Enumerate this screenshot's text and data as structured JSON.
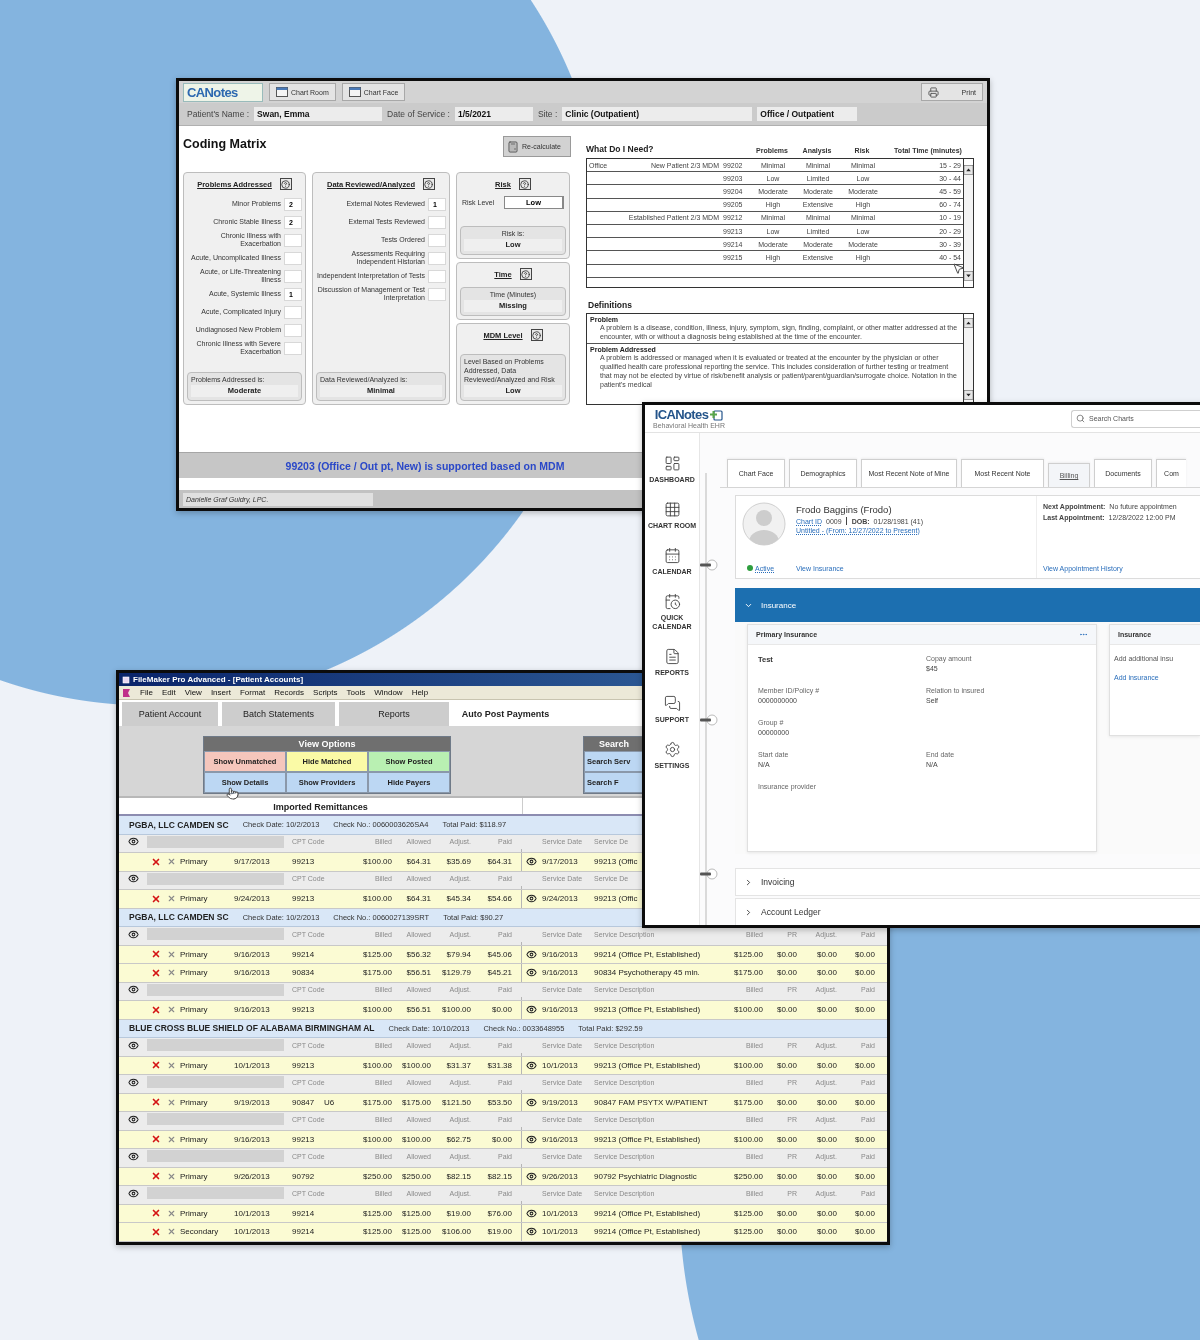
{
  "coding_matrix": {
    "logo": "CANotes",
    "toolbar": [
      "Chart Room",
      "Chart Face"
    ],
    "print_button": "Print",
    "patient_label": "Patient's Name :",
    "patient_name": "Swan, Emma",
    "date_label": "Date of Service :",
    "date": "1/5/2021",
    "site_label": "Site :",
    "site": "Clinic (Outpatient)",
    "setting": "Office / Outpatient",
    "title": "Coding Matrix",
    "recalculate_button": "Re-calculate",
    "panels": [
      {
        "title": "Problems Addressed",
        "items": [
          {
            "label": "Minor Problems",
            "value": "2"
          },
          {
            "label": "Chronic Stable Illness",
            "value": "2"
          },
          {
            "label": "Chronic Illness with Exacerbation"
          },
          {
            "label": "Acute, Uncomplicated Illness"
          },
          {
            "label": "Acute, or Life-Threatening Illness"
          },
          {
            "label": "Acute, Systemic Illness",
            "value": "1"
          },
          {
            "label": "Acute, Complicated Injury"
          },
          {
            "label": "Undiagnosed New Problem"
          },
          {
            "label": "Chronic Illness with Severe Exacerbation"
          }
        ],
        "summary_label": "Problems Addressed is:",
        "summary": "Moderate"
      },
      {
        "title": "Data Reviewed/Analyzed",
        "items": [
          {
            "label": "External Notes Reviewed",
            "value": "1"
          },
          {
            "label": "External Tests Reviewed"
          },
          {
            "label": "Tests Ordered"
          },
          {
            "label": "Assessments Requiring Independent Historian"
          },
          {
            "label": "Independent Interpretation of Tests"
          },
          {
            "label": "Discussion of Management or Test Interpretation"
          }
        ],
        "summary_label": "Data Reviewed/Analyzed is:",
        "summary": "Minimal"
      }
    ],
    "risk": {
      "title": "Risk",
      "field_label": "Risk Level",
      "field_value": "Low",
      "summary_label": "Risk is:",
      "summary": "Low"
    },
    "time": {
      "title": "Time",
      "summary_label": "Time (Minutes)",
      "summary": "Missing"
    },
    "mdm": {
      "title": "MDM Level",
      "summary_label": "Level Based on Problems Addressed, Data Reviewed/Analyzed and Risk",
      "summary": "Low"
    },
    "guide": {
      "title": "What Do I Need?",
      "columns": [
        "Problems",
        "Analysis",
        "Risk",
        "Total Time (minutes)"
      ],
      "rows": [
        {
          "column_1": "Office",
          "column_2": "New Patient 2/3 MDM",
          "code": "99202",
          "problems": "Minimal",
          "analysis": "Minimal",
          "risk": "Minimal",
          "time": "15 - 29"
        },
        {
          "code": "99203",
          "problems": "Low",
          "analysis": "Limited",
          "risk": "Low",
          "time": "30 - 44"
        },
        {
          "code": "99204",
          "problems": "Moderate",
          "analysis": "Moderate",
          "risk": "Moderate",
          "time": "45 - 59"
        },
        {
          "code": "99205",
          "problems": "High",
          "analysis": "Extensive",
          "risk": "High",
          "time": "60 - 74"
        },
        {
          "column_2": "Established Patient 2/3 MDM",
          "code": "99212",
          "problems": "Minimal",
          "analysis": "Minimal",
          "risk": "Minimal",
          "time": "10 - 19"
        },
        {
          "code": "99213",
          "problems": "Low",
          "analysis": "Limited",
          "risk": "Low",
          "time": "20 - 29"
        },
        {
          "code": "99214",
          "problems": "Moderate",
          "analysis": "Moderate",
          "risk": "Moderate",
          "time": "30 - 39"
        },
        {
          "code": "99215",
          "problems": "High",
          "analysis": "Extensive",
          "risk": "High",
          "time": "40 - 54"
        }
      ]
    },
    "definitions": {
      "title": "Definitions",
      "entries": [
        {
          "term": "Problem",
          "text": "A problem is a disease, condition, illness, injury, symptom, sign, finding, complaint, or other matter addressed at the encounter, with or without a diagnosis being established at the time of the encounter."
        },
        {
          "term": "Problem Addressed",
          "text": "A problem is addressed or managed when it is evaluated or treated at the encounter by the physician or other qualified health care professional reporting the service. This includes consideration of further testing or treatment that may not be elected by virtue of risk/benefit analysis or patient/parent/guardian/surrogate choice. Notation in the patient's medical"
        }
      ]
    },
    "result": "99203 (Office / Out pt, New) is supported based on MDM",
    "footer": "Danielle Graf Guidry, LPC."
  },
  "icanotes": {
    "logo": "ICANotes",
    "tagline": "Behavioral Health EHR",
    "search": {
      "placeholder": "Search Charts"
    },
    "nav": [
      {
        "label": "DASHBOARD",
        "kind": "dashboard"
      },
      {
        "label": "CHART ROOM",
        "kind": "chart_room"
      },
      {
        "label": "CALENDAR",
        "kind": "calendar"
      },
      {
        "label": "QUICK CALENDAR",
        "kind": "quick_calendar"
      },
      {
        "label": "REPORTS",
        "kind": "reports"
      },
      {
        "label": "SUPPORT",
        "kind": "support"
      },
      {
        "label": "SETTINGS",
        "kind": "settings"
      }
    ],
    "tabs": [
      {
        "label": "Chart Face",
        "selected": false
      },
      {
        "label": "Demographics",
        "selected": false
      },
      {
        "label": "Most Recent Note of Mine",
        "selected": false
      },
      {
        "label": "Most Recent Note",
        "selected": false
      },
      {
        "label": "Billing",
        "selected": true
      },
      {
        "label": "Documents",
        "selected": false
      },
      {
        "label": "Com",
        "selected": false
      }
    ],
    "patient": {
      "name": "Frodo Baggins (Frodo)",
      "chart_id_link": "Chart ID",
      "chart_id": "0009",
      "dob_label": "DOB:",
      "dob": "01/28/1981 (41)",
      "episode_link": "Untitled - (From: 12/27/2022 to Present)",
      "status": {
        "label": "Active",
        "active": true
      },
      "insurance_link": "View Insurance",
      "next_label": "Next Appointment:",
      "next": "No future appointmen",
      "last_label": "Last Appointment:",
      "last": "12/28/2022 12:00 PM",
      "history_link": "View Appointment History"
    },
    "sections": [
      {
        "title": "Insurance",
        "expanded": true
      },
      {
        "title": "Invoicing",
        "expanded": false
      },
      {
        "title": "Account Ledger",
        "expanded": false
      }
    ],
    "primary_card": {
      "title": "Primary Insurance",
      "rows": [
        [
          {
            "heading": "Test"
          },
          {
            "label": "Copay amount",
            "value": "$45"
          }
        ],
        [
          {
            "label": "Member ID/Policy #",
            "value": "0000000000"
          },
          {
            "label": "Relation to insured",
            "value": "Self"
          }
        ],
        [
          {
            "label": "Group #",
            "value": "00000000"
          }
        ],
        [
          {
            "label": "Start date",
            "value": "N/A"
          },
          {
            "label": "End date",
            "value": "N/A"
          }
        ],
        [
          {
            "label": "Insurance provider"
          }
        ]
      ]
    },
    "secondary_card": {
      "title": "Insurance",
      "text": "Add additional insu",
      "link": "Add insurance"
    }
  },
  "filemaker": {
    "title": "FileMaker Pro Advanced - [Patient Accounts]",
    "menu": [
      "File",
      "Edit",
      "View",
      "Insert",
      "Format",
      "Records",
      "Scripts",
      "Tools",
      "Window",
      "Help"
    ],
    "tabs": [
      {
        "label": "Patient Account",
        "selected": false
      },
      {
        "label": "Batch Statements",
        "selected": false
      },
      {
        "label": "Reports",
        "selected": false
      },
      {
        "label": "Auto Post Payments",
        "selected": true
      }
    ],
    "view_options": {
      "title": "View Options",
      "buttons": [
        {
          "label": "Show Unmatched",
          "color": "#f5c6bc"
        },
        {
          "label": "Hide Matched",
          "color": "#fafaa6"
        },
        {
          "label": "Show Posted",
          "color": "#b9f0b2"
        },
        {
          "label": "Show Details",
          "color": "#bcd7f3"
        },
        {
          "label": "Show Providers",
          "color": "#bcd7f3"
        },
        {
          "label": "Hide Payers",
          "color": "#bcd7f3"
        }
      ]
    },
    "search": {
      "title": "Search",
      "buttons": [
        "Search Serv",
        "Search F"
      ]
    },
    "heading": "Imported Remittances",
    "payers": [
      {
        "payer": "PGBA, LLC CAMDEN SC",
        "check_date": "Check Date: 10/2/2013",
        "check_no": "Check No.: 0060003626SA4",
        "total": "Total Paid: $118.97",
        "claims": [
          {
            "columns": [
              "CPT Code",
              "Billed",
              "Allowed",
              "Adjust.",
              "Paid",
              "Service Date",
              "Service De"
            ],
            "lines": [
              {
                "coverage": "Primary",
                "date": "9/17/2013",
                "cpt": "99213",
                "amounts": [
                  "$100.00",
                  "$64.31",
                  "$35.69",
                  "$64.31"
                ],
                "service_date": "9/17/2013",
                "description": "99213 (Offic"
              }
            ]
          },
          {
            "columns": [
              "CPT Code",
              "Billed",
              "Allowed",
              "Adjust.",
              "Paid",
              "Service Date",
              "Service De"
            ],
            "lines": [
              {
                "coverage": "Primary",
                "date": "9/24/2013",
                "cpt": "99213",
                "amounts": [
                  "$100.00",
                  "$64.31",
                  "$45.34",
                  "$54.66"
                ],
                "service_date": "9/24/2013",
                "description": "99213 (Offic"
              }
            ]
          }
        ]
      },
      {
        "payer": "PGBA, LLC CAMDEN SC",
        "check_date": "Check Date: 10/2/2013",
        "check_no": "Check No.: 0060027139SRT",
        "total": "Total Paid: $90.27",
        "claims": [
          {
            "columns": [
              "CPT Code",
              "Billed",
              "Allowed",
              "Adjust.",
              "Paid",
              "Service Date",
              "Service Description",
              "Billed",
              "PR",
              "Adjust.",
              "Paid"
            ],
            "lines": [
              {
                "coverage": "Primary",
                "date": "9/16/2013",
                "cpt": "99214",
                "amounts": [
                  "$125.00",
                  "$56.32",
                  "$79.94",
                  "$45.06"
                ],
                "service_date": "9/16/2013",
                "description": "99214 (Office Pt, Established)",
                "service_amounts": [
                  "$125.00",
                  "$0.00",
                  "$0.00",
                  "$0.00"
                ]
              },
              {
                "coverage": "Primary",
                "date": "9/16/2013",
                "cpt": "90834",
                "amounts": [
                  "$175.00",
                  "$56.51",
                  "$129.79",
                  "$45.21"
                ],
                "service_date": "9/16/2013",
                "description": "90834 Psychotherapy 45 min.",
                "service_amounts": [
                  "$175.00",
                  "$0.00",
                  "$0.00",
                  "$0.00"
                ]
              }
            ]
          },
          {
            "columns": [
              "CPT Code",
              "Billed",
              "Allowed",
              "Adjust.",
              "Paid",
              "Service Date",
              "Service Description",
              "Billed",
              "PR",
              "Adjust.",
              "Paid"
            ],
            "lines": [
              {
                "coverage": "Primary",
                "date": "9/16/2013",
                "cpt": "99213",
                "amounts": [
                  "$100.00",
                  "$56.51",
                  "$100.00",
                  "$0.00"
                ],
                "service_date": "9/16/2013",
                "description": "99213 (Office Pt, Established)",
                "service_amounts": [
                  "$100.00",
                  "$0.00",
                  "$0.00",
                  "$0.00"
                ]
              }
            ]
          }
        ]
      },
      {
        "payer": "BLUE CROSS BLUE SHIELD OF ALABAMA BIRMINGHAM AL",
        "check_date": "Check Date: 10/10/2013",
        "check_no": "Check No.: 0033648955",
        "total": "Total Paid: $292.59",
        "claims": [
          {
            "columns": [
              "CPT Code",
              "Billed",
              "Allowed",
              "Adjust.",
              "Paid",
              "Service Date",
              "Service Description",
              "Billed",
              "PR",
              "Adjust.",
              "Paid"
            ],
            "lines": [
              {
                "coverage": "Primary",
                "date": "10/1/2013",
                "cpt": "99213",
                "amounts": [
                  "$100.00",
                  "$100.00",
                  "$31.37",
                  "$31.38"
                ],
                "service_date": "10/1/2013",
                "description": "99213 (Office Pt, Established)",
                "service_amounts": [
                  "$100.00",
                  "$0.00",
                  "$0.00",
                  "$0.00"
                ]
              }
            ]
          },
          {
            "columns": [
              "CPT Code",
              "Billed",
              "Allowed",
              "Adjust.",
              "Paid",
              "Service Date",
              "Service Description",
              "Billed",
              "PR",
              "Adjust.",
              "Paid"
            ],
            "lines": [
              {
                "coverage": "Primary",
                "date": "9/19/2013",
                "cpt": "90847",
                "modifier": "U6",
                "amounts": [
                  "$175.00",
                  "$175.00",
                  "$121.50",
                  "$53.50"
                ],
                "service_date": "9/19/2013",
                "description": "90847 FAM PSYTX W/PATIENT",
                "service_amounts": [
                  "$175.00",
                  "$0.00",
                  "$0.00",
                  "$0.00"
                ]
              }
            ]
          },
          {
            "columns": [
              "CPT Code",
              "Billed",
              "Allowed",
              "Adjust.",
              "Paid",
              "Service Date",
              "Service Description",
              "Billed",
              "PR",
              "Adjust.",
              "Paid"
            ],
            "lines": [
              {
                "coverage": "Primary",
                "date": "9/16/2013",
                "cpt": "99213",
                "amounts": [
                  "$100.00",
                  "$100.00",
                  "$62.75",
                  "$0.00"
                ],
                "service_date": "9/16/2013",
                "description": "99213 (Office Pt, Established)",
                "service_amounts": [
                  "$100.00",
                  "$0.00",
                  "$0.00",
                  "$0.00"
                ]
              }
            ]
          },
          {
            "columns": [
              "CPT Code",
              "Billed",
              "Allowed",
              "Adjust.",
              "Paid",
              "Service Date",
              "Service Description",
              "Billed",
              "PR",
              "Adjust.",
              "Paid"
            ],
            "lines": [
              {
                "coverage": "Primary",
                "date": "9/26/2013",
                "cpt": "90792",
                "amounts": [
                  "$250.00",
                  "$250.00",
                  "$82.15",
                  "$82.15"
                ],
                "service_date": "9/26/2013",
                "description": "90792 Psychiatric Diagnostic",
                "service_amounts": [
                  "$250.00",
                  "$0.00",
                  "$0.00",
                  "$0.00"
                ]
              }
            ]
          },
          {
            "columns": [
              "CPT Code",
              "Billed",
              "Allowed",
              "Adjust.",
              "Paid",
              "Service Date",
              "Service Description",
              "Billed",
              "PR",
              "Adjust.",
              "Paid"
            ],
            "lines": [
              {
                "coverage": "Primary",
                "date": "10/1/2013",
                "cpt": "99214",
                "amounts": [
                  "$125.00",
                  "$125.00",
                  "$19.00",
                  "$76.00"
                ],
                "service_date": "10/1/2013",
                "description": "99214 (Office Pt, Established)",
                "service_amounts": [
                  "$125.00",
                  "$0.00",
                  "$0.00",
                  "$0.00"
                ]
              },
              {
                "coverage": "Secondary",
                "date": "10/1/2013",
                "cpt": "99214",
                "amounts": [
                  "$125.00",
                  "$125.00",
                  "$106.00",
                  "$19.00"
                ],
                "service_date": "10/1/2013",
                "description": "99214 (Office Pt, Established)",
                "service_amounts": [
                  "$125.00",
                  "$0.00",
                  "$0.00",
                  "$0.00"
                ]
              }
            ]
          }
        ]
      }
    ]
  }
}
